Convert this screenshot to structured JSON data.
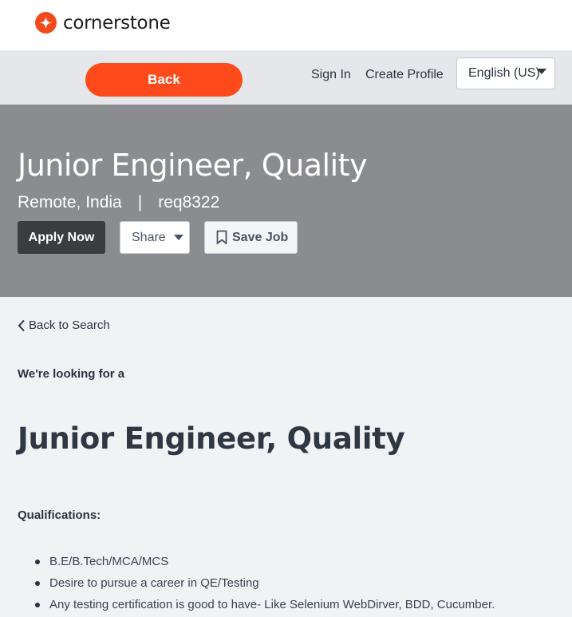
{
  "brand": {
    "name": "cornerstone",
    "accent": "#ff4a1c"
  },
  "nav": {
    "back_label": "Back",
    "sign_in": "Sign In",
    "create_profile": "Create Profile",
    "language": "English (US)"
  },
  "hero": {
    "title": "Junior Engineer, Quality",
    "location": "Remote, India",
    "separator": "|",
    "req_id": "req8322",
    "apply_label": "Apply Now",
    "share_label": "Share",
    "save_label": "Save Job"
  },
  "content": {
    "back_to_search": "Back to Search",
    "intro": "We're looking for a",
    "job_title": "Junior Engineer, Quality",
    "qualifications_heading": "Qualifications:",
    "qualifications": [
      "B.E/B.Tech/MCA/MCS",
      "Desire to pursue a career in QE/Testing",
      "Any testing certification is good to have- Like Selenium WebDirver, BDD, Cucumber."
    ]
  }
}
